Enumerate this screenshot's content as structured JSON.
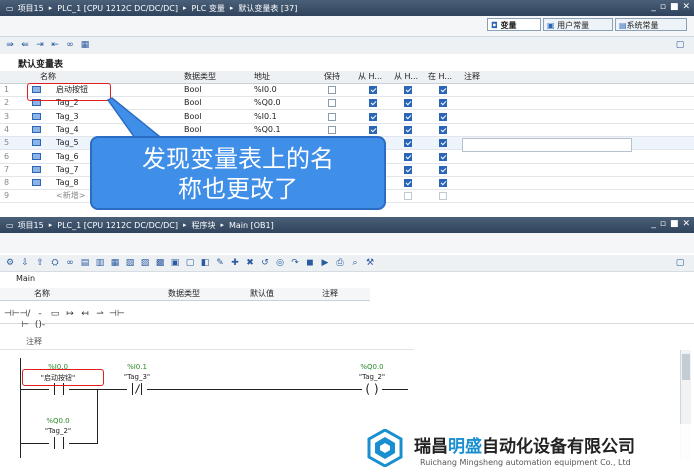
{
  "top_window": {
    "breadcrumb": [
      "项目15",
      "PLC_1 [CPU 1212C DC/DC/DC]",
      "PLC 变量",
      "默认变量表 [37]"
    ],
    "tabs": [
      {
        "label": "变量",
        "active": true
      },
      {
        "label": "用户常量",
        "active": false
      },
      {
        "label": "系统常量",
        "active": false
      }
    ],
    "table_title": "默认变量表",
    "columns": [
      "名称",
      "数据类型",
      "地址",
      "保持",
      "从 H...",
      "从 H...",
      "在 H...",
      "注释"
    ],
    "rows": [
      {
        "num": "1",
        "name": "启动按钮",
        "type": "Bool",
        "addr": "%I0.0",
        "retain": false,
        "c1": true,
        "c2": true,
        "c3": true
      },
      {
        "num": "2",
        "name": "Tag_2",
        "type": "Bool",
        "addr": "%Q0.0",
        "retain": false,
        "c1": true,
        "c2": true,
        "c3": true
      },
      {
        "num": "3",
        "name": "Tag_3",
        "type": "Bool",
        "addr": "%I0.1",
        "retain": false,
        "c1": true,
        "c2": true,
        "c3": true
      },
      {
        "num": "4",
        "name": "Tag_4",
        "type": "Bool",
        "addr": "%Q0.1",
        "retain": false,
        "c1": true,
        "c2": true,
        "c3": true
      },
      {
        "num": "5",
        "name": "Tag_5",
        "type": "",
        "addr": "",
        "retain": false,
        "c1": true,
        "c2": true,
        "c3": true
      },
      {
        "num": "6",
        "name": "Tag_6",
        "type": "",
        "addr": "",
        "retain": false,
        "c1": true,
        "c2": true,
        "c3": true
      },
      {
        "num": "7",
        "name": "Tag_7",
        "type": "",
        "addr": "",
        "retain": false,
        "c1": true,
        "c2": true,
        "c3": true
      },
      {
        "num": "8",
        "name": "Tag_8",
        "type": "",
        "addr": "",
        "retain": false,
        "c1": true,
        "c2": true,
        "c3": true
      },
      {
        "num": "9",
        "name": "<新增>",
        "type": "",
        "addr": "",
        "retain": false,
        "c1": false,
        "c2": false,
        "c3": false
      }
    ],
    "callout_text_line1": "发现变量表上的名",
    "callout_text_line2": "称也更改了"
  },
  "bottom_window": {
    "breadcrumb": [
      "项目15",
      "PLC_1 [CPU 1212C DC/DC/DC]",
      "程序块",
      "Main [OB1]"
    ],
    "block_name": "Main",
    "interface_columns": [
      "名称",
      "数据类型",
      "默认值",
      "注释"
    ],
    "comment_label": "注释",
    "network": {
      "contact1": {
        "addr": "%I0.0",
        "name": "\"启动按钮\""
      },
      "contact2": {
        "addr": "%I0.1",
        "name": "\"Tag_3\""
      },
      "coil": {
        "addr": "%Q0.0",
        "name": "\"Tag_2\""
      },
      "branch_contact": {
        "addr": "%Q0.0",
        "name": "\"Tag_2\""
      }
    }
  },
  "watermark": {
    "company_cn_1": "瑞昌",
    "company_cn_2": "明盛",
    "company_cn_3": "自动化设备有限公司",
    "company_en": "Ruichang Mingsheng automation equipment Co., Ltd",
    "brand_color": "#1a8fd0"
  },
  "colors": {
    "accent": "#2a66b8",
    "callout": "#3f8ee8",
    "highlight": "#e02020"
  }
}
